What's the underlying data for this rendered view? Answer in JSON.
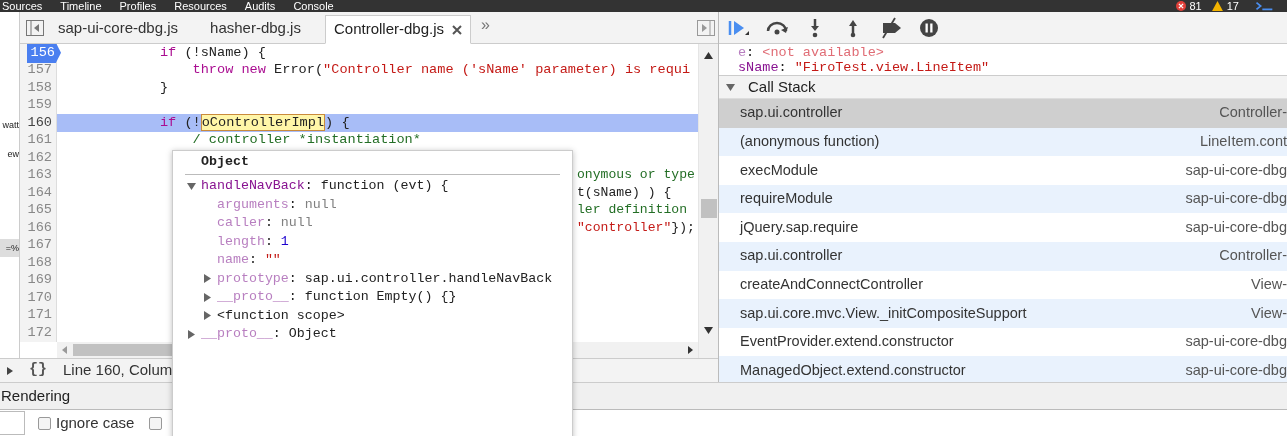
{
  "top_tabs": [
    "Sources",
    "Timeline",
    "Profiles",
    "Resources",
    "Audits",
    "Console"
  ],
  "counters": {
    "errors": "81",
    "warnings": "17"
  },
  "left_strip": [
    "watt",
    "ew",
    "=%"
  ],
  "file_tabs": [
    {
      "label": "sap-ui-core-dbg.js",
      "selected": false
    },
    {
      "label": "hasher-dbg.js",
      "selected": false
    },
    {
      "label": "Controller-dbg.js",
      "selected": true
    }
  ],
  "more_tabs": "»",
  "code_lines": [
    {
      "number": "156",
      "breakpoint": true,
      "current": false,
      "tokens": [
        {
          "kind": "keyword",
          "text": "            if"
        },
        {
          "kind": "plain",
          "text": " (!sName) {"
        }
      ]
    },
    {
      "number": "157",
      "breakpoint": false,
      "current": false,
      "tokens": [
        {
          "kind": "keyword",
          "text": "                throw new"
        },
        {
          "kind": "plain",
          "text": " Error("
        },
        {
          "kind": "string",
          "text": "\"Controller name ('sName' parameter) is requi"
        }
      ]
    },
    {
      "number": "158",
      "breakpoint": false,
      "current": false,
      "tokens": [
        {
          "kind": "plain",
          "text": "            }"
        }
      ]
    },
    {
      "number": "159",
      "breakpoint": false,
      "current": false
    },
    {
      "number": "160",
      "breakpoint": false,
      "current": true,
      "tokens": [
        {
          "kind": "keyword",
          "text": "            if"
        },
        {
          "kind": "plain",
          "text": " (!"
        },
        {
          "kind": "hover",
          "text": "oControllerImpl"
        },
        {
          "kind": "plain",
          "text": ") {"
        }
      ]
    },
    {
      "number": "161",
      "breakpoint": false,
      "current": false,
      "tokens": [
        {
          "kind": "comment",
          "text": "                / controller *instantiation*"
        }
      ]
    },
    {
      "number": "162",
      "breakpoint": false,
      "current": false
    },
    {
      "number": "163",
      "breakpoint": false,
      "current": false,
      "tail": [
        {
          "kind": "comment",
          "text": "onymous or type"
        }
      ]
    },
    {
      "number": "164",
      "breakpoint": false,
      "current": false,
      "tail": [
        {
          "kind": "plain",
          "text": "t(sName) ) {"
        }
      ]
    },
    {
      "number": "165",
      "breakpoint": false,
      "current": false,
      "tail": [
        {
          "kind": "comment",
          "text": "ler definition"
        }
      ]
    },
    {
      "number": "166",
      "breakpoint": false,
      "current": false,
      "tail": [
        {
          "kind": "string",
          "text": "\"controller\""
        },
        {
          "kind": "plain",
          "text": "});"
        }
      ]
    },
    {
      "number": "167",
      "breakpoint": false,
      "current": false
    },
    {
      "number": "168",
      "breakpoint": false,
      "current": false
    },
    {
      "number": "169",
      "breakpoint": false,
      "current": false
    },
    {
      "number": "170",
      "breakpoint": false,
      "current": false
    },
    {
      "number": "171",
      "breakpoint": false,
      "current": false
    },
    {
      "number": "172",
      "breakpoint": false,
      "current": false
    }
  ],
  "status": {
    "pretty_print": "{}",
    "position": "Line 160, Colum"
  },
  "drawer": {
    "tab": "Rendering",
    "checkboxes": [
      {
        "label": "Ignore case",
        "checked": false
      },
      {
        "checked": false
      }
    ]
  },
  "popup": {
    "title": "Object",
    "entries": [
      {
        "kind": "node",
        "expanded": true,
        "key": {
          "kind": "own",
          "text": "handleNavBack"
        },
        "separator": ":",
        "value": {
          "kind": "plain",
          "text": "function (evt) {"
        },
        "children": [
          {
            "kind": "leaf",
            "key": {
              "kind": "hidden",
              "text": "arguments"
            },
            "separator": ":",
            "value": {
              "kind": "null",
              "text": "null"
            }
          },
          {
            "kind": "leaf",
            "key": {
              "kind": "hidden",
              "text": "caller"
            },
            "separator": ":",
            "value": {
              "kind": "null",
              "text": "null"
            }
          },
          {
            "kind": "leaf",
            "key": {
              "kind": "hidden",
              "text": "length"
            },
            "separator": ":",
            "value": {
              "kind": "number",
              "text": "1"
            }
          },
          {
            "kind": "leaf",
            "key": {
              "kind": "hidden",
              "text": "name"
            },
            "separator": ":",
            "value": {
              "kind": "string",
              "text": "\"\""
            }
          },
          {
            "kind": "node",
            "expanded": false,
            "key": {
              "kind": "hidden",
              "text": "prototype"
            },
            "separator": ":",
            "value": {
              "kind": "plain",
              "text": "sap.ui.controller.handleNavBack"
            }
          },
          {
            "kind": "node",
            "expanded": false,
            "key": {
              "kind": "hidden",
              "text": "__proto__"
            },
            "separator": ":",
            "value": {
              "kind": "plain",
              "text": "function Empty() {}"
            }
          },
          {
            "kind": "node",
            "expanded": false,
            "key": {
              "kind": "internal",
              "text": "<function scope>"
            }
          }
        ]
      },
      {
        "kind": "node",
        "expanded": false,
        "key": {
          "kind": "hidden",
          "text": "__proto__"
        },
        "separator": ":",
        "value": {
          "kind": "plain",
          "text": "Object"
        }
      }
    ]
  },
  "scope": [
    {
      "key": {
        "kind": "hidden",
        "text": "e"
      },
      "separator": ":",
      "value": {
        "kind": "unavailable",
        "text": "<not available>"
      }
    },
    {
      "key": {
        "kind": "own",
        "text": "sName"
      },
      "separator": ":",
      "value": {
        "kind": "string",
        "text": "\"FiroTest.view.LineItem\""
      }
    }
  ],
  "call_stack": {
    "title": "Call Stack",
    "expanded": true,
    "frames": [
      {
        "name": "sap.ui.controller",
        "location": "Controller-",
        "selected": true
      },
      {
        "name": "(anonymous function)",
        "location": "LineItem.cont",
        "selected": false
      },
      {
        "name": "execModule",
        "location": "sap-ui-core-dbg",
        "selected": false
      },
      {
        "name": "requireModule",
        "location": "sap-ui-core-dbg",
        "selected": false
      },
      {
        "name": "jQuery.sap.require",
        "location": "sap-ui-core-dbg",
        "selected": false
      },
      {
        "name": "sap.ui.controller",
        "location": "Controller-",
        "selected": false
      },
      {
        "name": "createAndConnectController",
        "location": "View-",
        "selected": false
      },
      {
        "name": "sap.ui.core.mvc.View._initCompositeSupport",
        "location": "View-",
        "selected": false
      },
      {
        "name": "EventProvider.extend.constructor",
        "location": "sap-ui-core-dbg",
        "selected": false
      },
      {
        "name": "ManagedObject.extend.constructor",
        "location": "sap-ui-core-dbg",
        "selected": false
      }
    ]
  }
}
